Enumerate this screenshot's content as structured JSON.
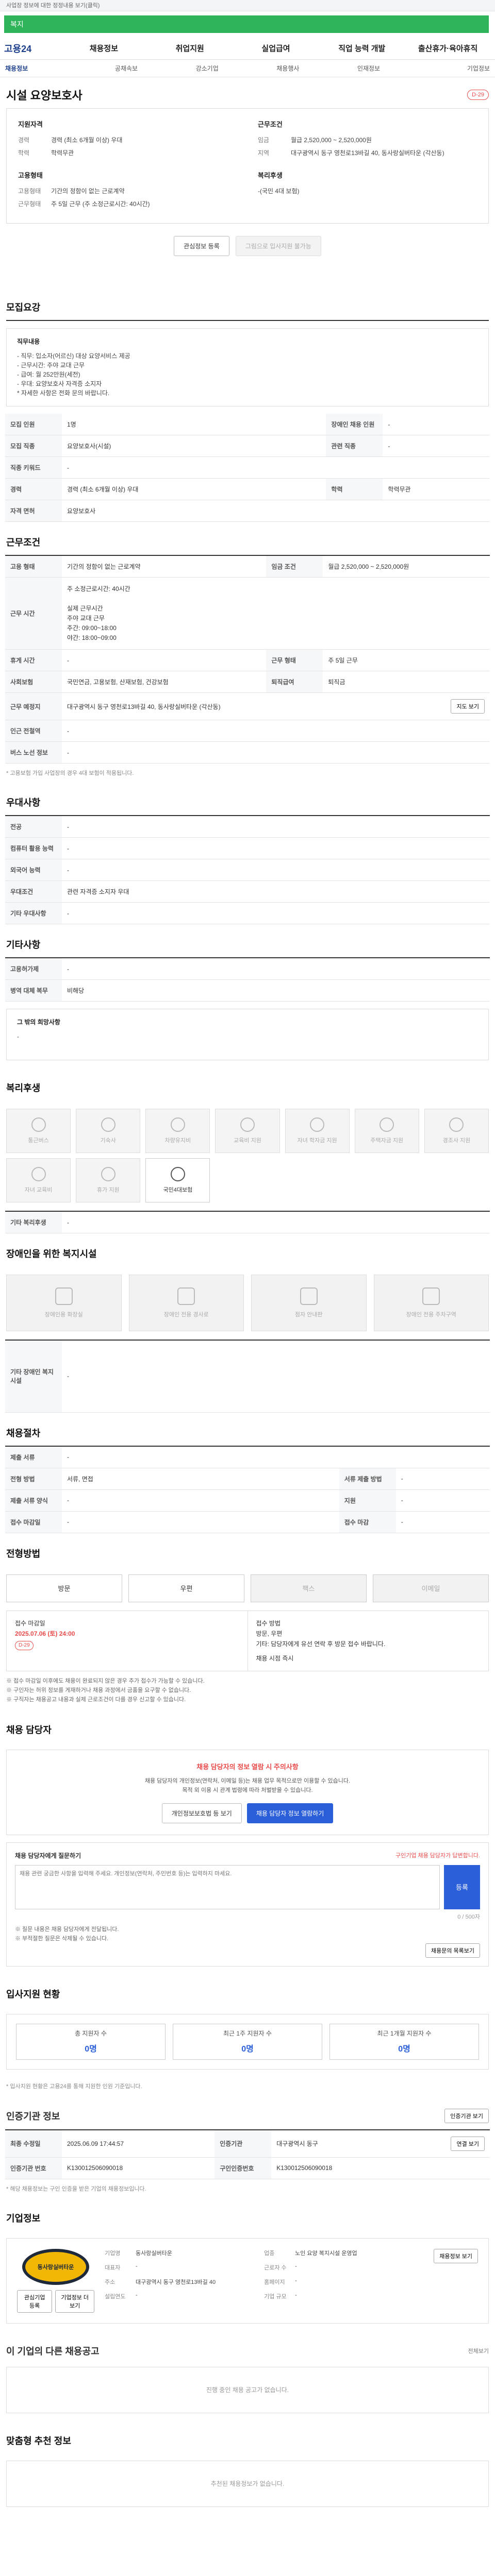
{
  "notice": "사업장 정보에 대한 정정내용 보기(클릭)",
  "search": {
    "value": "복지"
  },
  "logo": "고용24",
  "gnb": [
    "채용정보",
    "취업지원",
    "실업급여",
    "직업 능력 개발",
    "출산휴가·육아휴직"
  ],
  "subtabs": [
    "채용정보",
    "공채속보",
    "강소기업",
    "채용행사",
    "인재정보",
    "기업정보"
  ],
  "job": {
    "title": "시설 요양보호사",
    "dday": "D-29",
    "summary": {
      "qual_head": "지원자격",
      "cond_head": "근무조건",
      "employ_head": "고용형태",
      "welfare_head": "복리후생",
      "career_k": "경력",
      "career_v": "경력 (최소 6개월 이상) 우대",
      "edu_k": "학력",
      "edu_v": "학력무관",
      "wage_k": "임금",
      "wage_v": "월급 2,520,000 ~ 2,520,000원",
      "region_k": "지역",
      "region_v": "대구광역시 동구 영천로13바길 40, 동사랑실버타운 (각산동)",
      "employ_k": "고용형태",
      "employ_v": "기간의 정함이 없는 근로계약",
      "hours_k": "근무형태",
      "hours_v": "주 5일 근무 (주 소정근로시간: 40시간)",
      "welfare_v": "-(국민 4대 보험)"
    },
    "buttons": {
      "scrap": "관심정보 등록",
      "apply": "그림으로 입사지원 불가능"
    }
  },
  "recruit": {
    "h": "모집요강",
    "duty_title": "직무내용",
    "duty_lines": [
      "- 직무: 입소자(어르신) 대상 요양서비스 제공",
      "- 근무시간: 주야 교대 근무",
      "- 급여: 월 252만원(세전)",
      "- 우대: 요양보호사 자격증 소지자",
      "* 자세한 사항은 전화 문의 바랍니다."
    ],
    "rows": [
      [
        "모집 인원",
        "1명",
        "장애인 채용 인원",
        "-"
      ],
      [
        "모집 직종",
        "요양보호사(시설)",
        "관련 직종",
        "-"
      ],
      [
        "직종 키워드",
        "-",
        "",
        ""
      ],
      [
        "경력",
        "경력 (최소 6개월 이상) 우대",
        "학력",
        "학력무관"
      ],
      [
        "자격 면허",
        "요양보호사",
        "",
        ""
      ]
    ]
  },
  "cond": {
    "h": "근무조건",
    "rows1": [
      [
        "고용 형태",
        "기간의 정함이 없는 근로계약",
        "임금 조건",
        "월급 2,520,000 ~ 2,520,000원"
      ]
    ],
    "hours_k": "근무 시간",
    "hours_lines": [
      "주 소정근로시간: 40시간",
      "",
      "실제 근무시간",
      "주야 교대 근무",
      "주간: 09:00~18:00",
      "야간: 18:00~09:00"
    ],
    "rows2": [
      [
        "휴게 시간",
        "-",
        "근무 형태",
        "주 5일 근무"
      ],
      [
        "사회보험",
        "국민연금, 고용보험, 산재보험, 건강보험",
        "퇴직급여",
        "퇴직금"
      ],
      [
        "근무 예정지",
        "대구광역시 동구 영천로13바길 40, 동사랑실버타운 (각산동)",
        "",
        "지도 보기"
      ],
      [
        "인근 전철역",
        "-",
        "",
        ""
      ],
      [
        "버스 노선 정보",
        "-",
        "",
        ""
      ]
    ],
    "note": "* 고용보험 가입 사업장의 경우 4대 보험이 적용됩니다."
  },
  "pref": {
    "h": "우대사항",
    "rows": [
      [
        "전공",
        "-"
      ],
      [
        "컴퓨터 활용 능력",
        "-"
      ],
      [
        "외국어 능력",
        "-"
      ],
      [
        "우대조건",
        "관련 자격증 소지자 우대"
      ],
      [
        "기타 우대사항",
        "-"
      ]
    ]
  },
  "etc": {
    "h": "기타사항",
    "rows": [
      [
        "고용허가제",
        "-"
      ],
      [
        "병역 대체 복무",
        "비해당"
      ]
    ],
    "other_title": "그 밖의 희망사항",
    "other_v": "-"
  },
  "welfare": {
    "h": "복리후생",
    "items": [
      "통근버스",
      "기숙사",
      "차량유지비",
      "교육비 지원",
      "자녀 학자금 지원",
      "주택자금 지원",
      "경조사 지원",
      "자녀 교육비",
      "휴가 지원",
      "국민4대보험"
    ],
    "rows": [
      [
        "기타 복리후생",
        "-"
      ]
    ]
  },
  "disab": {
    "h": "장애인을 위한 복지시설",
    "items": [
      "장애인용 화장실",
      "장애인 전용 경사로",
      "점자 안내판",
      "장애인 전용 주차구역"
    ],
    "rows": [
      [
        "기타 장애인 복지시설",
        "-"
      ]
    ]
  },
  "process": {
    "h": "채용절차",
    "rows": [
      [
        "제출 서류",
        "-",
        "",
        ""
      ],
      [
        "전형 방법",
        "서류, 면접",
        "서류 제출 방법",
        "-"
      ],
      [
        "제출 서류 양식",
        "-",
        "지원",
        "-"
      ],
      [
        "접수 마감일",
        "-",
        "접수 마감",
        "-"
      ]
    ]
  },
  "apply": {
    "h": "전형방법",
    "methods": [
      "방문",
      "우편",
      "팩스",
      "이메일"
    ],
    "period_k": "접수 마감일",
    "period_date": "2025.07.06 (토) 24:00",
    "period_dday": "D-29",
    "contact_k": "접수 방법",
    "contact_lines": [
      "방문, 우편",
      "기타: 담당자에게 유선 연락 후 방문 접수 바랍니다."
    ],
    "contact_phone_k": "채용 시점",
    "contact_phone_v": "즉시",
    "bullets": [
      "※ 접수 마감일 이후에도 채용이 완료되지 않은 경우 추가 접수가 가능할 수 있습니다.",
      "※ 구인자는 허위 정보를 게재하거나 채용 과정에서 금품을 요구할 수 없습니다.",
      "※ 구직자는 채용공고 내용과 실제 근로조건이 다를 경우 신고할 수 있습니다."
    ]
  },
  "manager": {
    "h": "채용 담당자",
    "alert_head": "채용 담당자의 정보 열람 시 주의사항",
    "alert_lines": [
      "채용 담당자의 개인정보(연락처, 이메일 등)는 채용 업무 목적으로만 이용할 수 있습니다.",
      "목적 외 이용 시 관계 법령에 따라 처벌받을 수 있습니다."
    ],
    "btn1": "개인정보보호법 등 보기",
    "btn2": "채용 담당자 정보 열람하기"
  },
  "qa": {
    "title": "채용 담당자에게 질문하기",
    "guide": "구인기업 채용 담당자가 답변합니다.",
    "placeholder": "채용 관련 궁금한 사항을 입력해 주세요. 개인정보(연락처, 주민번호 등)는 입력하지 마세요.",
    "submit": "등록",
    "count": "0 / 500자",
    "bullets": [
      "※ 질문 내용은 채용 담당자에게 전달됩니다.",
      "※ 부적절한 질문은 삭제될 수 있습니다."
    ],
    "btn_list": "채용문의 목록보기"
  },
  "stats": {
    "h": "입사지원 현황",
    "items": [
      [
        "총 지원자 수",
        "0명"
      ],
      [
        "최근 1주 지원자 수",
        "0명"
      ],
      [
        "최근 1개월 지원자 수",
        "0명"
      ]
    ],
    "note": "* 입사지원 현황은 고용24를 통해 지원한 인원 기준입니다."
  },
  "auth": {
    "h": "인증기관 정보",
    "btn": "인증기관 보기",
    "rows": [
      [
        "최종 수정일",
        "2025.06.09 17:44:57",
        "인증기관",
        "대구광역시 동구",
        "연결 보기"
      ],
      [
        "인증기관 번호",
        "K130012506090018",
        "구인인증번호",
        "K130012506090018",
        ""
      ]
    ],
    "note": "* 해당 채용정보는 구인 인증을 받은 기업의 채용정보입니다."
  },
  "company": {
    "h": "기업정보",
    "logo_text": "동사랑실버타운",
    "btn1": "관심기업 등록",
    "btn2": "기업정보 더보기",
    "rows": [
      [
        "기업명",
        "동사랑실버타운",
        "업종",
        "노인 요양 복지시설 운영업"
      ],
      [
        "대표자",
        "-",
        "근로자 수",
        "-"
      ],
      [
        "주소",
        "대구광역시 동구 영천로13바길 40",
        "홈페이지",
        "-"
      ],
      [
        "설립연도",
        "-",
        "기업 규모",
        "-"
      ]
    ],
    "apply_btn": "채용정보 보기"
  },
  "other": {
    "h": "이 기업의 다른 채용공고",
    "more": "전체보기",
    "empty": "진행 중인 채용 공고가 없습니다."
  },
  "recommend": {
    "h": "맞춤형 추천 정보",
    "empty": "추천된 채용정보가 없습니다."
  }
}
